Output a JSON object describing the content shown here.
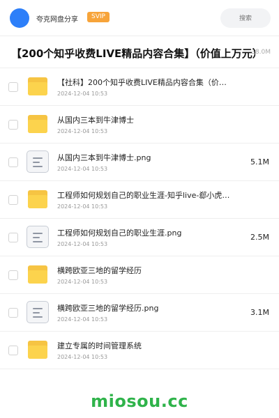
{
  "header": {
    "username": "夸克网盘分享",
    "badge": "SVIP",
    "search_placeholder": "搜索",
    "accent_color": "#2d7ff9",
    "badge_color": "#f7a43a"
  },
  "folder_title": {
    "text": "【200个知乎收费LIVE精品内容合集】（价值上万元）",
    "size": "38.0M"
  },
  "files": [
    {
      "type": "folder",
      "name": "【社科】200个知乎收费LIVE精品内容合集（价值…",
      "date": "2024-12-04 10:53",
      "size": ""
    },
    {
      "type": "folder",
      "name": "从国内三本到牛津博士",
      "date": "2024-12-04 10:53",
      "size": ""
    },
    {
      "type": "image",
      "name": "从国内三本到牛津博士.png",
      "date": "2024-12-04 10:53",
      "size": "5.1M"
    },
    {
      "type": "folder",
      "name": "工程师如何规划自己的职业生涯-知乎live-郄小虎…",
      "date": "2024-12-04 10:53",
      "size": ""
    },
    {
      "type": "image",
      "name": "工程师如何规划自己的职业生涯.png",
      "date": "2024-12-04 10:53",
      "size": "2.5M"
    },
    {
      "type": "folder",
      "name": "横跨欧亚三地的留学经历",
      "date": "2024-12-04 10:53",
      "size": ""
    },
    {
      "type": "image",
      "name": "横跨欧亚三地的留学经历.png",
      "date": "2024-12-04 10:53",
      "size": "3.1M"
    },
    {
      "type": "folder",
      "name": "建立专属的时间管理系统",
      "date": "2024-12-04 10:53",
      "size": ""
    }
  ],
  "watermark": {
    "text": "miosou.cc",
    "color": "#2fb34a"
  }
}
